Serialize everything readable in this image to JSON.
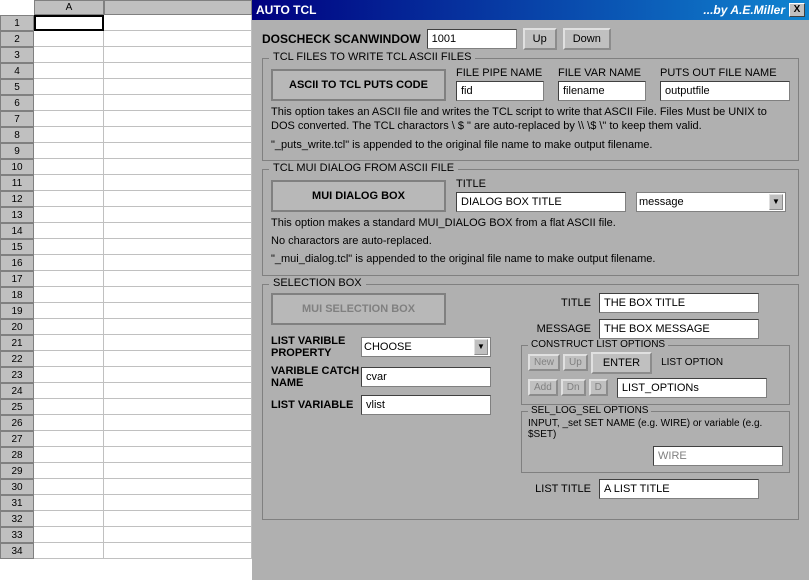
{
  "spreadsheet": {
    "col_a": "A",
    "rows": [
      "1",
      "2",
      "3",
      "4",
      "5",
      "6",
      "7",
      "8",
      "9",
      "10",
      "11",
      "12",
      "13",
      "14",
      "15",
      "16",
      "17",
      "18",
      "19",
      "20",
      "21",
      "22",
      "23",
      "24",
      "25",
      "26",
      "27",
      "28",
      "29",
      "30",
      "31",
      "32",
      "33",
      "34"
    ]
  },
  "titlebar": {
    "title": "AUTO TCL",
    "author": "...by A.E.Miller",
    "close": "X"
  },
  "doscheck": {
    "label": "DOSCHECK SCANWINDOW",
    "value": "1001",
    "up": "Up",
    "down": "Down"
  },
  "tclwrite": {
    "legend": "TCL FILES TO WRITE TCL ASCII FILES",
    "button": "ASCII TO TCL PUTS CODE",
    "pipe_label": "FILE PIPE NAME",
    "pipe_value": "fid",
    "var_label": "FILE VAR NAME",
    "var_value": "filename",
    "out_label": "PUTS OUT FILE NAME",
    "out_value": "outputfile",
    "help1": "This option takes an ASCII file and writes the TCL script to write that ASCII File.  Files Must be UNIX to DOS converted.  The TCL charactors \\ $ \" are auto-replaced by \\\\ \\$ \\\" to keep them valid.",
    "help2": "\"_puts_write.tcl\" is appended to the original file name to make output filename."
  },
  "mui": {
    "legend": "TCL MUI DIALOG FROM ASCII FILE",
    "button": "MUI DIALOG BOX",
    "title_label": "TITLE",
    "title_value": "DIALOG BOX TITLE",
    "msg_value": "message",
    "help1": "This option makes a standard MUI_DIALOG BOX from a flat ASCII file.",
    "help2": "No charactors are auto-replaced.",
    "help3": "\"_mui_dialog.tcl\" is appended to the original file name to make output filename."
  },
  "selbox": {
    "legend": "SELECTION BOX",
    "button": "MUI SELECTION BOX",
    "title_label": "TITLE",
    "title_value": "THE BOX TITLE",
    "msg_label": "MESSAGE",
    "msg_value": "THE BOX MESSAGE",
    "lvp_label": "LIST VARIBLE PROPERTY",
    "lvp_value": "CHOOSE",
    "vcn_label": "VARIBLE CATCH NAME",
    "vcn_value": "cvar",
    "lv_label": "LIST VARIABLE",
    "lv_value": "vlist",
    "construct": {
      "legend": "CONSTRUCT LIST OPTIONS",
      "new": "New",
      "up": "Up",
      "enter": "ENTER",
      "add": "Add",
      "dn": "Dn",
      "d": "D",
      "opt_label": "LIST OPTION",
      "opt_value": "LIST_OPTIONs"
    },
    "sellog": {
      "legend": "SEL_LOG_SEL OPTIONS",
      "help": "INPUT, _set SET NAME (e.g. WIRE) or variable (e.g. $SET)",
      "wire": "WIRE",
      "lt_label": "LIST TITLE",
      "lt_value": "A LIST TITLE"
    }
  }
}
